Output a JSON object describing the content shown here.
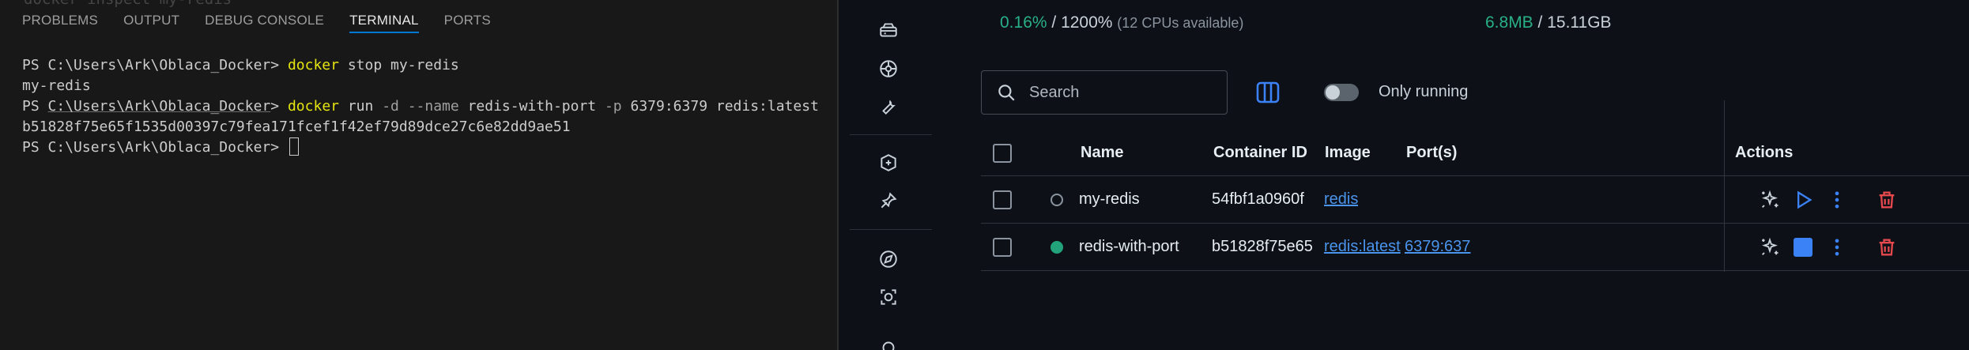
{
  "vscode": {
    "ghost_line": "docker inspect my-redis",
    "tabs": [
      "PROBLEMS",
      "OUTPUT",
      "DEBUG CONSOLE",
      "TERMINAL",
      "PORTS"
    ],
    "active_tab": "TERMINAL",
    "terminal": {
      "line1": {
        "prompt_prefix": "PS C:\\Users\\Ark\\Oblaca_Docker> ",
        "cmd": "docker",
        "rest": " stop my-redis"
      },
      "line2": "my-redis",
      "line3": {
        "ps": "PS ",
        "path": "C:\\Users\\Ark\\Oblaca_Docker",
        "gt": "> ",
        "cmd": "docker",
        "run": " run ",
        "flag_d": "-d",
        "flag_name": " --name",
        "name_val": " redis-with-port ",
        "flag_p": "-p",
        "ports": " 6379:6379 redis:latest"
      },
      "line4": "b51828f75e65f1535d00397c79fea171fcef1f42ef79d89dce27c6e82dd9ae51",
      "line5_prompt": "PS C:\\Users\\Ark\\Oblaca_Docker> "
    }
  },
  "docker": {
    "cpu": {
      "value": "0.16%",
      "sep": " / ",
      "max": "1200%",
      "note": "(12 CPUs available)"
    },
    "memory": {
      "value": "6.8MB",
      "sep": " / ",
      "max": "15.11GB"
    },
    "search": {
      "placeholder": "Search"
    },
    "only_running_label": "Only running",
    "columns": {
      "name": "Name",
      "container_id": "Container ID",
      "image": "Image",
      "ports": "Port(s)",
      "actions": "Actions"
    },
    "rows": [
      {
        "status": "stopped",
        "name": "my-redis",
        "container_id": "54fbf1a0960f",
        "image": "redis",
        "ports": ""
      },
      {
        "status": "running",
        "name": "redis-with-port",
        "container_id": "b51828f75e65",
        "image": "redis:latest",
        "ports": "6379:637"
      }
    ],
    "colors": {
      "running": "#23a37a",
      "link": "#4a94ec",
      "delete": "#e5484d",
      "accent": "#3b82f6"
    },
    "rail_icons": [
      "dashboard-icon",
      "containers-icon",
      "extensions-icon",
      "build-icon",
      "scout-icon",
      "tools-icon",
      "volumes-icon",
      "learning-icon"
    ]
  }
}
